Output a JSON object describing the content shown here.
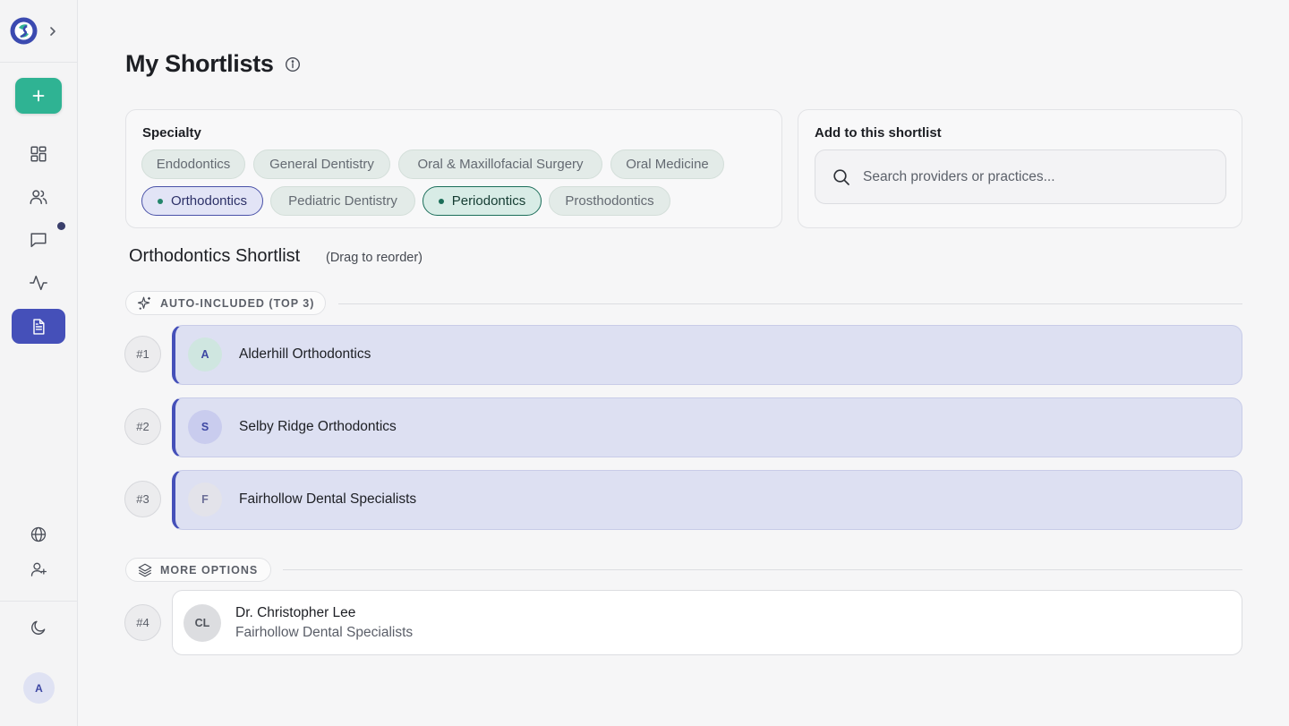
{
  "sidebar": {
    "avatar_initial": "A",
    "icons": [
      "dashboard-icon",
      "users-icon",
      "messages-icon",
      "activity-icon",
      "document-icon",
      "globe-icon",
      "add-user-icon",
      "moon-icon"
    ]
  },
  "page": {
    "title": "My Shortlists"
  },
  "specialty": {
    "label": "Specialty",
    "chips": [
      {
        "label": "Endodontics",
        "selected": false
      },
      {
        "label": "General Dentistry",
        "selected": false
      },
      {
        "label": "Oral & Maxillofacial Surgery",
        "selected": false
      },
      {
        "label": "Oral Medicine",
        "selected": false
      },
      {
        "label": "Orthodontics",
        "selected": true
      },
      {
        "label": "Pediatric Dentistry",
        "selected": false
      },
      {
        "label": "Periodontics",
        "selected": true
      },
      {
        "label": "Prosthodontics",
        "selected": false
      }
    ]
  },
  "add": {
    "label": "Add to this shortlist",
    "search_placeholder": "Search providers or practices..."
  },
  "shortlist": {
    "title": "Orthodontics Shortlist",
    "hint": "(Drag to reorder)",
    "auto_label": "AUTO-INCLUDED (TOP 3)",
    "more_label": "MORE OPTIONS",
    "auto_items": [
      {
        "rank": "#1",
        "initial": "A",
        "name": "Alderhill Orthodontics"
      },
      {
        "rank": "#2",
        "initial": "S",
        "name": "Selby Ridge Orthodontics"
      },
      {
        "rank": "#3",
        "initial": "F",
        "name": "Fairhollow Dental Specialists"
      }
    ],
    "more_items": [
      {
        "rank": "#4",
        "initial": "CL",
        "name": "Dr. Christopher Lee",
        "practice": "Fairhollow Dental Specialists"
      }
    ]
  },
  "colors": {
    "accent": "#4550b9",
    "primary_action": "#2fb393",
    "row_bg": "#dde0f2"
  }
}
